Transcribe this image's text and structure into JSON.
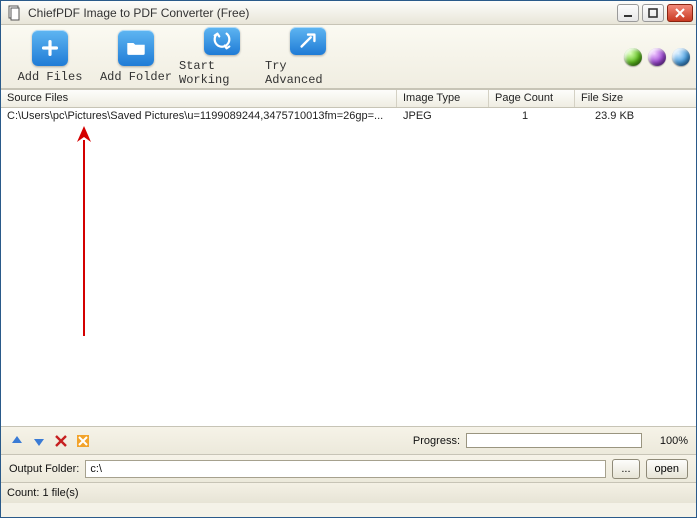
{
  "window": {
    "title": "ChiefPDF Image to PDF Converter (Free)"
  },
  "toolbar": {
    "add_files": "Add Files",
    "add_folder": "Add Folder",
    "start_working": "Start Working",
    "try_advanced": "Try Advanced"
  },
  "columns": {
    "source": "Source Files",
    "type": "Image Type",
    "page": "Page Count",
    "size": "File Size"
  },
  "rows": [
    {
      "source": "C:\\Users\\pc\\Pictures\\Saved Pictures\\u=1199089244,3475710013fm=26gp=...",
      "type": "JPEG",
      "page": "1",
      "size": "23.9 KB"
    }
  ],
  "progress": {
    "label": "Progress:",
    "percent_text": "100%"
  },
  "output": {
    "label": "Output Folder:",
    "path": "c:\\",
    "browse": "...",
    "open": "open"
  },
  "status": {
    "count_label": "Count:  1 file(s)"
  }
}
